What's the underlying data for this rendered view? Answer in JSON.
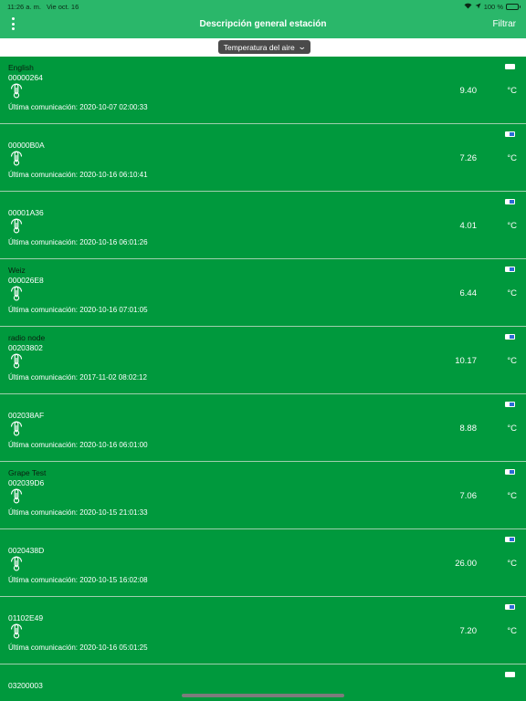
{
  "status_bar": {
    "time": "11:26 a. m.",
    "date": "Vie oct. 16",
    "battery_percent": "100 %",
    "battery_level": 1.0
  },
  "nav": {
    "title": "Descripción general estación",
    "filter_label": "Filtrar"
  },
  "selector": {
    "label": "Temperatura del aire"
  },
  "stations": [
    {
      "name": "English",
      "id": "00000264",
      "last_comm": "Última comunicación: 2020-10-07 02:00:33",
      "value": "9.40",
      "unit": "°C",
      "battery": "full"
    },
    {
      "name": "",
      "id": "00000B0A",
      "last_comm": "Última comunicación: 2020-10-16 06:10:41",
      "value": "7.26",
      "unit": "°C",
      "battery": "partial"
    },
    {
      "name": "",
      "id": "00001A36",
      "last_comm": "Última comunicación: 2020-10-16 06:01:26",
      "value": "4.01",
      "unit": "°C",
      "battery": "partial"
    },
    {
      "name": "Weiz",
      "id": "000026E8",
      "last_comm": "Última comunicación: 2020-10-16 07:01:05",
      "value": "6.44",
      "unit": "°C",
      "battery": "partial"
    },
    {
      "name": "radio node",
      "id": "00203802",
      "last_comm": "Última comunicación: 2017-11-02 08:02:12",
      "value": "10.17",
      "unit": "°C",
      "battery": "partial"
    },
    {
      "name": "",
      "id": "002038AF",
      "last_comm": "Última comunicación: 2020-10-16 06:01:00",
      "value": "8.88",
      "unit": "°C",
      "battery": "partial"
    },
    {
      "name": "Grape Test",
      "id": "002039D6",
      "last_comm": "Última comunicación: 2020-10-15 21:01:33",
      "value": "7.06",
      "unit": "°C",
      "battery": "partial"
    },
    {
      "name": "",
      "id": "0020438D",
      "last_comm": "Última comunicación: 2020-10-15 16:02:08",
      "value": "26.00",
      "unit": "°C",
      "battery": "partial"
    },
    {
      "name": "",
      "id": "01102E49",
      "last_comm": "Última comunicación: 2020-10-16 05:01:25",
      "value": "7.20",
      "unit": "°C",
      "battery": "partial"
    },
    {
      "name": "",
      "id": "03200003",
      "last_comm": "",
      "value": "",
      "unit": "",
      "battery": "full"
    }
  ]
}
